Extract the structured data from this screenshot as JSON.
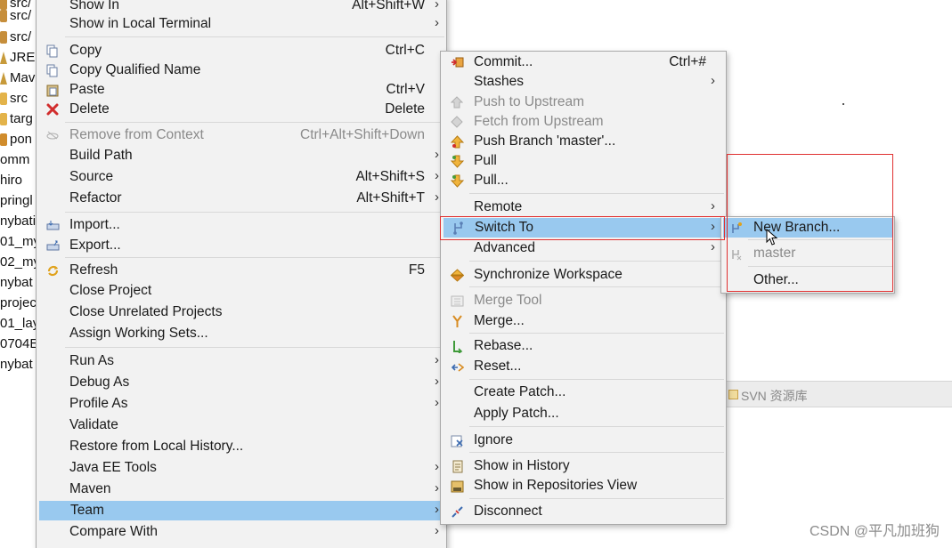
{
  "explorer": {
    "items": [
      "src/",
      "src/",
      "JRE",
      "Mav",
      "src",
      "targ",
      "pon",
      "omm",
      "hiro",
      "pringl",
      "nybati",
      "01_my",
      "02_my",
      "nybat",
      "projec",
      "01_lay",
      "0704El",
      "nybat"
    ]
  },
  "main_menu": {
    "items": [
      {
        "label": "Show In",
        "accel": "Alt+Shift+W",
        "submenu": true
      },
      {
        "label": "Show in Local Terminal",
        "accel": "",
        "submenu": true
      },
      {
        "label": "Copy",
        "accel": "Ctrl+C",
        "icon": "copy-icon"
      },
      {
        "label": "Copy Qualified Name",
        "accel": "",
        "icon": "copy-qualified-icon"
      },
      {
        "label": "Paste",
        "accel": "Ctrl+V",
        "icon": "paste-icon"
      },
      {
        "label": "Delete",
        "accel": "Delete",
        "icon": "delete-icon"
      },
      {
        "label": "Remove from Context",
        "accel": "Ctrl+Alt+Shift+Down",
        "disabled": true,
        "icon": "remove-context-icon"
      },
      {
        "label": "Build Path",
        "accel": "",
        "submenu": true
      },
      {
        "label": "Source",
        "accel": "Alt+Shift+S",
        "submenu": true
      },
      {
        "label": "Refactor",
        "accel": "Alt+Shift+T",
        "submenu": true
      },
      {
        "label": "Import...",
        "accel": "",
        "icon": "import-icon"
      },
      {
        "label": "Export...",
        "accel": "",
        "icon": "export-icon"
      },
      {
        "label": "Refresh",
        "accel": "F5",
        "icon": "refresh-icon"
      },
      {
        "label": "Close Project",
        "accel": ""
      },
      {
        "label": "Close Unrelated Projects",
        "accel": ""
      },
      {
        "label": "Assign Working Sets...",
        "accel": ""
      },
      {
        "label": "Run As",
        "accel": "",
        "submenu": true
      },
      {
        "label": "Debug As",
        "accel": "",
        "submenu": true
      },
      {
        "label": "Profile As",
        "accel": "",
        "submenu": true
      },
      {
        "label": "Validate",
        "accel": ""
      },
      {
        "label": "Restore from Local History...",
        "accel": ""
      },
      {
        "label": "Java EE Tools",
        "accel": "",
        "submenu": true
      },
      {
        "label": "Maven",
        "accel": "",
        "submenu": true
      },
      {
        "label": "Team",
        "accel": "",
        "submenu": true,
        "selected": true
      },
      {
        "label": "Compare With",
        "accel": "",
        "submenu": true
      }
    ],
    "arrow": "›"
  },
  "team_menu": {
    "items": [
      {
        "label": "Commit...",
        "accel": "Ctrl+#",
        "icon": "commit-icon"
      },
      {
        "label": "Stashes",
        "accel": "",
        "submenu": true
      },
      {
        "label": "Push to Upstream",
        "disabled": true,
        "icon": "push-upstream-icon"
      },
      {
        "label": "Fetch from Upstream",
        "disabled": true,
        "icon": "fetch-upstream-icon"
      },
      {
        "label": "Push Branch 'master'...",
        "icon": "push-branch-icon"
      },
      {
        "label": "Pull",
        "icon": "pull-icon"
      },
      {
        "label": "Pull...",
        "icon": "pull-dialog-icon"
      },
      {
        "label": "Remote",
        "submenu": true
      },
      {
        "label": "Switch To",
        "submenu": true,
        "selected": true,
        "icon": "switch-to-icon"
      },
      {
        "label": "Advanced",
        "submenu": true
      },
      {
        "label": "Synchronize Workspace",
        "icon": "synchronize-icon"
      },
      {
        "label": "Merge Tool",
        "disabled": true,
        "icon": "merge-tool-icon"
      },
      {
        "label": "Merge...",
        "icon": "merge-icon"
      },
      {
        "label": "Rebase...",
        "icon": "rebase-icon"
      },
      {
        "label": "Reset...",
        "icon": "reset-icon"
      },
      {
        "label": "Create Patch..."
      },
      {
        "label": "Apply Patch..."
      },
      {
        "label": "Ignore",
        "icon": "ignore-icon"
      },
      {
        "label": "Show in History",
        "icon": "history-icon"
      },
      {
        "label": "Show in Repositories View",
        "icon": "repositories-icon"
      },
      {
        "label": "Disconnect",
        "icon": "disconnect-icon"
      }
    ]
  },
  "switch_menu": {
    "items": [
      {
        "label": "New Branch...",
        "selected": true,
        "icon": "new-branch-icon"
      },
      {
        "label": "master",
        "disabled": true,
        "icon": "branch-icon"
      },
      {
        "label": "Other..."
      }
    ]
  },
  "background_view": {
    "label": "SVN 资源库"
  },
  "watermark": "CSDN @平凡加班狗",
  "colors": {
    "menu_bg": "#f2f2f2",
    "selection": "#99c9ef",
    "disabled_text": "#8a8a8a",
    "highlight_box": "#e03030"
  }
}
